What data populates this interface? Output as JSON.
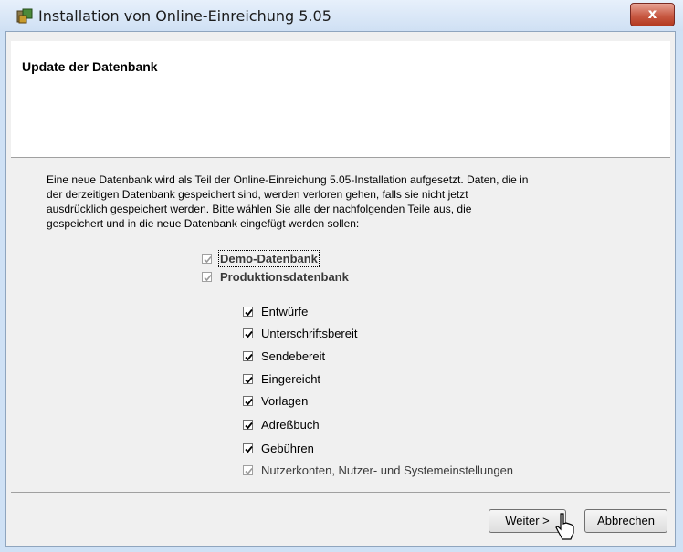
{
  "window": {
    "title": "Installation von Online-Einreichung 5.05",
    "close_glyph": "x"
  },
  "header": {
    "title": "Update der Datenbank"
  },
  "description": {
    "lines": [
      "Eine neue Datenbank wird als Teil der Online-Einreichung 5.05-Installation aufgesetzt. Daten, die in",
      "der derzeitigen Datenbank gespeichert sind, werden verloren gehen, falls sie nicht jetzt",
      "ausdrücklich gespeichert werden. Bitte wählen Sie alle der nachfolgenden Teile aus, die",
      "gespeichert und in die neue Datenbank eingefügt werden sollen:"
    ]
  },
  "databases": [
    {
      "label": "Demo-Datenbank",
      "checked": true,
      "enabled": false
    },
    {
      "label": "Produktionsdatenbank",
      "checked": true,
      "enabled": false
    }
  ],
  "items": [
    {
      "label": "Entwürfe",
      "checked": true,
      "enabled": true
    },
    {
      "label": "Unterschriftsbereit",
      "checked": true,
      "enabled": true
    },
    {
      "label": "Sendebereit",
      "checked": true,
      "enabled": true
    },
    {
      "label": "Eingereicht",
      "checked": true,
      "enabled": true
    },
    {
      "label": "Vorlagen",
      "checked": true,
      "enabled": true
    },
    {
      "label": "Adreßbuch",
      "checked": true,
      "enabled": true
    },
    {
      "label": "Gebühren",
      "checked": true,
      "enabled": true
    },
    {
      "label": "Nutzerkonten, Nutzer- und Systemeinstellungen",
      "checked": true,
      "enabled": false
    }
  ],
  "buttons": {
    "next": "Weiter >",
    "cancel": "Abbrechen"
  }
}
